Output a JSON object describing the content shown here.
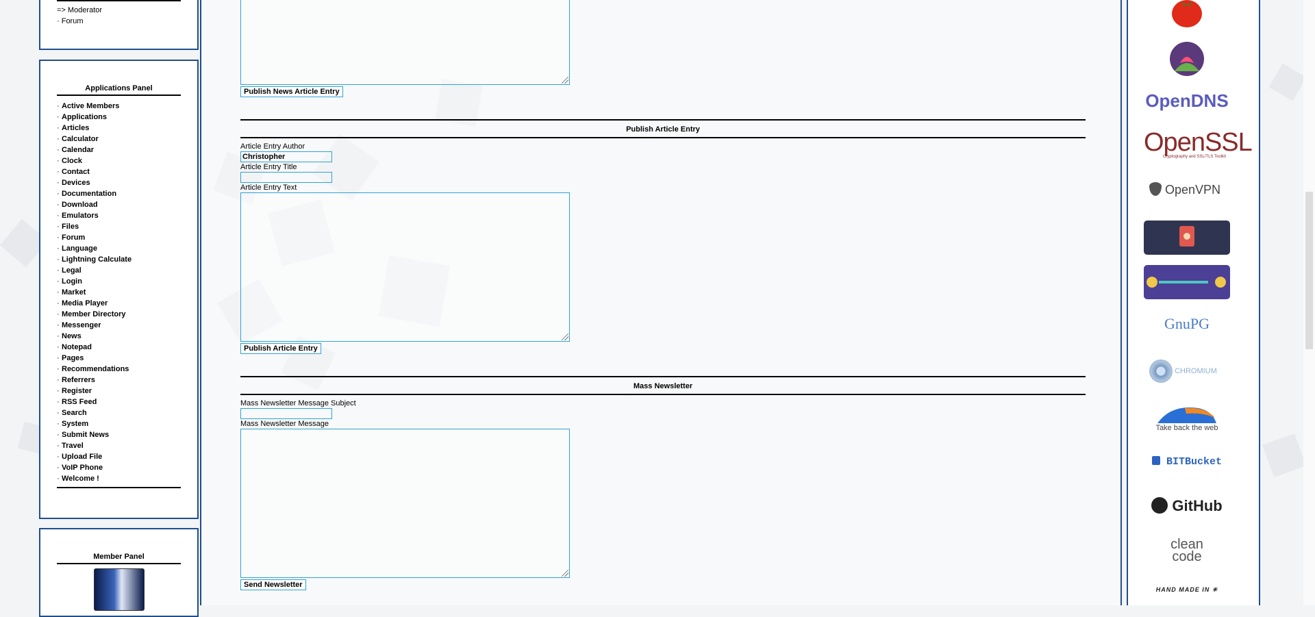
{
  "top_panel": {
    "items": [
      "=> Moderator",
      "· Forum"
    ]
  },
  "applications_panel": {
    "title": "Applications Panel",
    "items": [
      "Active Members",
      "Applications",
      "Articles",
      "Calculator",
      "Calendar",
      "Clock",
      "Contact",
      "Devices",
      "Documentation",
      "Download",
      "Emulators",
      "Files",
      "Forum",
      "Language",
      "Lightning Calculate",
      "Legal",
      "Login",
      "Market",
      "Media Player",
      "Member Directory",
      "Messenger",
      "News",
      "Notepad",
      "Pages",
      "Recommendations",
      "Referrers",
      "Register",
      "RSS Feed",
      "Search",
      "System",
      "Submit News",
      "Travel",
      "Upload File",
      "VoIP Phone",
      "Welcome !"
    ]
  },
  "member_panel": {
    "title": "Member Panel"
  },
  "news_form": {
    "publish_button": "Publish News Article Entry"
  },
  "article_form": {
    "heading": "Publish Article Entry",
    "author_label": "Article Entry Author",
    "author_value": "Christopher",
    "title_label": "Article Entry Title",
    "title_value": "",
    "text_label": "Article Entry Text",
    "publish_button": "Publish Article Entry"
  },
  "newsletter_form": {
    "heading": "Mass Newsletter",
    "subject_label": "Mass Newsletter Message Subject",
    "subject_value": "",
    "message_label": "Mass Newsletter Message",
    "send_button": "Send Newsletter"
  },
  "badges": {
    "opendns": "OpenDNS",
    "openssl": "OpenSSL",
    "openssl_sub": "Cryptography and SSL/TLS Toolkit",
    "openvpn": "OpenVPN",
    "gnupg": "GnuPG",
    "chromium": "CHROMIUM",
    "firefox": "Take back the web",
    "bitbucket": "BITBucket",
    "github": "GitHub",
    "cleancode_1": "clean",
    "cleancode_2": "code",
    "handmade": "HAND MADE IN"
  },
  "colors": {
    "panel_border": "#1f4e8c",
    "field_border": "#2ea3d4"
  }
}
